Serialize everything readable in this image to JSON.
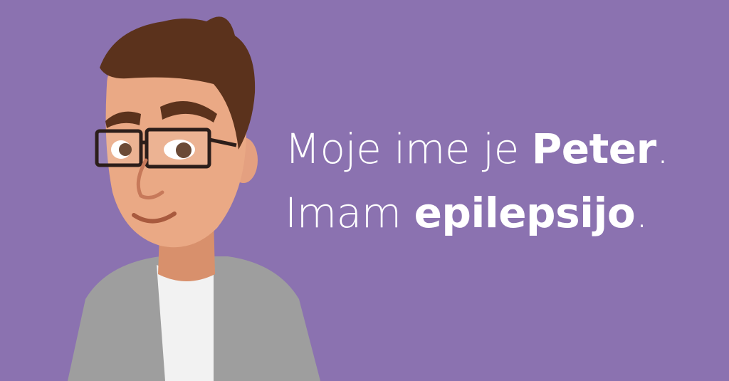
{
  "caption": {
    "line1": {
      "prefix": "Moje ime je ",
      "name": "Peter",
      "suffix": "."
    },
    "line2": {
      "prefix": "Imam ",
      "condition": "epilepsijo",
      "suffix": "."
    }
  },
  "colors": {
    "background": "#8b72b0",
    "text": "#ffffff",
    "hair": "#5b321c",
    "skin": "#e8a785",
    "jacket": "#9e9e9e",
    "shirt": "#f2f2f2"
  },
  "illustration": {
    "subject": "man-with-glasses-icon"
  }
}
